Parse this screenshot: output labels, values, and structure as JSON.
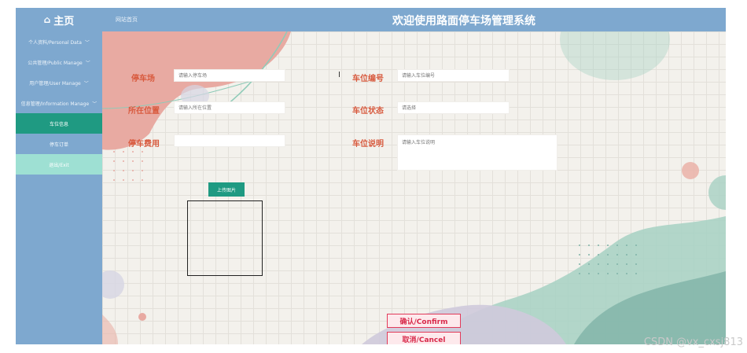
{
  "header": {
    "home_icon": "home-icon",
    "home_label": "主页",
    "site_link": "网站首页",
    "system_title": "欢迎使用路面停车场管理系统"
  },
  "sidebar": {
    "items": [
      {
        "label": "个人资料/Personal Data",
        "chevron": true
      },
      {
        "label": "公共管理/Public Manage",
        "chevron": true
      },
      {
        "label": "用户管理/User Manage",
        "chevron": true
      },
      {
        "label": "信息管理/Information Manage",
        "chevron": true
      },
      {
        "label": "车位信息"
      },
      {
        "label": "停车订单"
      },
      {
        "label": "退出/Exit"
      }
    ]
  },
  "form": {
    "parking_lot_label": "停车场",
    "parking_lot_placeholder": "请输入停车场",
    "location_label": "所在位置",
    "location_placeholder": "请输入所在位置",
    "fee_label": "停车费用",
    "fee_placeholder": "",
    "space_no_label": "车位编号",
    "space_no_placeholder": "请输入车位编号",
    "status_label": "车位状态",
    "status_placeholder": "请选择",
    "desc_label": "车位说明",
    "desc_placeholder": "请输入车位说明",
    "upload_label": "上传图片",
    "confirm_label": "确认/Confirm",
    "cancel_label": "取消/Cancel"
  },
  "watermark": "CSDN @vx_cxsj813",
  "colors": {
    "sidebar_bg": "#7ea8cf",
    "active_item": "#1f9a82",
    "label_color": "#d85a3e",
    "button_border": "#e23b5a"
  }
}
